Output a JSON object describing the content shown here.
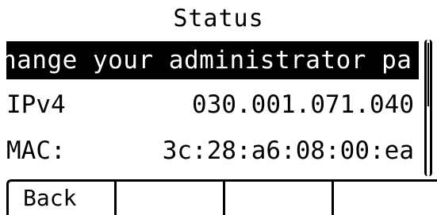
{
  "header": {
    "title": "Status"
  },
  "status_list": {
    "selected_item": "hange your administrator pa",
    "items": [
      {
        "label": "IPv4",
        "value": "030.001.071.040"
      },
      {
        "label": "MAC:",
        "value": "3c:28:a6:08:00:ea"
      }
    ]
  },
  "softkeys": {
    "key1": "Back",
    "key2": "",
    "key3": "",
    "key4": ""
  }
}
